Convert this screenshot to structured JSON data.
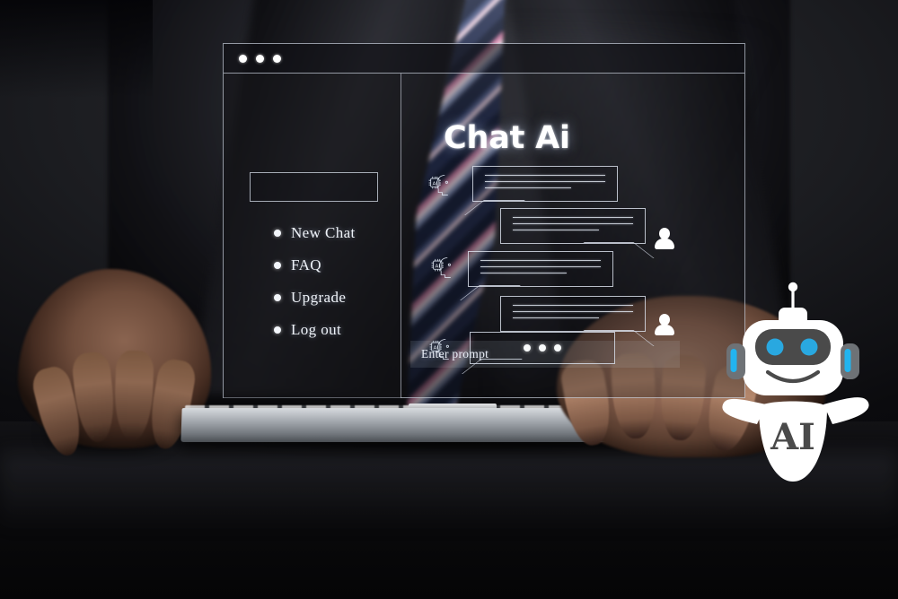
{
  "scene": {
    "description": "Businessman at desk using keyboard and mouse with holographic Chat Ai interface and white AI robot mascot",
    "background_photo": "man-in-dark-suit-with-striped-tie-hands-on-keyboard-and-mouse"
  },
  "window": {
    "title_bar_dots": [
      "dot-1",
      "dot-2",
      "dot-3"
    ],
    "sidebar": {
      "search_placeholder": "",
      "items": [
        {
          "label": "New Chat"
        },
        {
          "label": "FAQ"
        },
        {
          "label": "Upgrade"
        },
        {
          "label": "Log out"
        }
      ]
    },
    "chat": {
      "title": "Chat Ai",
      "messages": [
        {
          "role": "ai",
          "lines": 3,
          "icon": "ai-head-icon"
        },
        {
          "role": "user",
          "lines": 3,
          "icon": "user-avatar-icon"
        },
        {
          "role": "ai",
          "lines": 3,
          "icon": "ai-head-icon"
        },
        {
          "role": "user",
          "lines": 3,
          "icon": "user-avatar-icon"
        },
        {
          "role": "ai",
          "typing": true,
          "icon": "ai-head-icon"
        }
      ],
      "typing_dots": [
        "dot-1",
        "dot-2",
        "dot-3"
      ],
      "input": {
        "value": "",
        "placeholder": "Enter prompt"
      }
    }
  },
  "robot": {
    "label": "AI",
    "colors": {
      "body": "#ffffff",
      "visor": "#4a4a4a",
      "eye": "#29a8e0",
      "headphone": "#6e7276",
      "headphone_accent": "#22b4ef"
    }
  },
  "colors": {
    "hologram_line": "#e2e9f5",
    "accent_cyan": "#29a8e0",
    "window_fill": "#101115",
    "text": "#eef2f8"
  }
}
